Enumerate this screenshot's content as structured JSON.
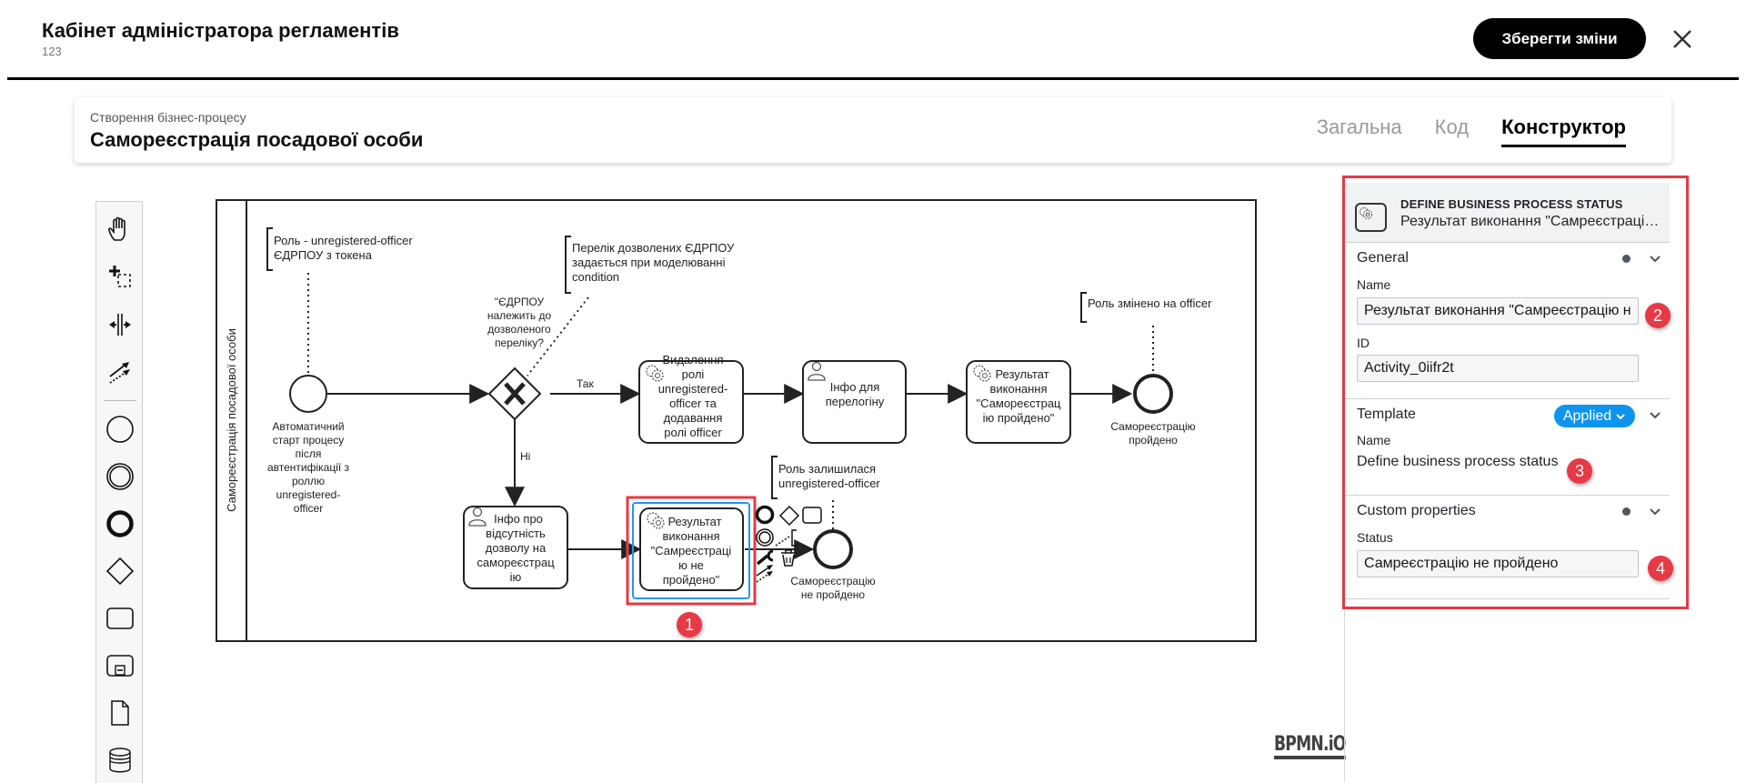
{
  "header": {
    "app_title": "Кабінет адміністратора регламентів",
    "app_subtitle": "123",
    "save_label": "Зберегти зміни",
    "close_icon": "close-icon"
  },
  "process": {
    "kicker": "Створення бізнес-процесу",
    "title": "Самореєстрація посадової особи",
    "tabs": [
      {
        "label": "Загальна",
        "active": false
      },
      {
        "label": "Код",
        "active": false
      },
      {
        "label": "Конструктор",
        "active": true
      }
    ]
  },
  "palette": {
    "tools": [
      "hand-tool-icon",
      "lasso-tool-icon",
      "space-tool-icon",
      "global-connect-tool-icon"
    ],
    "elements": [
      "start-event-icon",
      "intermediate-event-icon",
      "end-event-icon",
      "gateway-icon",
      "task-icon",
      "subprocess-icon",
      "data-object-icon",
      "data-store-icon"
    ]
  },
  "diagram": {
    "lane_label": "Самореєстрація посадової особи",
    "annotations": {
      "role_token": [
        "Роль - unregistered-officer",
        "ЄДРПОУ з токена"
      ],
      "edrpou_list": [
        "Перелік дозволених ЄДРПОУ",
        "задається при моделюванні",
        "condition"
      ],
      "role_changed": [
        "Роль змінено на officer"
      ],
      "role_stayed": [
        "Роль залишилася",
        "unregistered-officer"
      ]
    },
    "start_event_label": [
      "Автоматичний",
      "старт процесу",
      "після",
      "автентифікації з",
      "роллю",
      "unregistered-",
      "officer"
    ],
    "gateway_label": [
      "\"ЄДРПОУ",
      "належить до",
      "дозволеного",
      "переліку?"
    ],
    "flow_yes": "Так",
    "flow_no": "Ні",
    "tasks": {
      "remove_role": [
        "Видалення",
        "ролі",
        "unregistered-",
        "officer та",
        "додавання",
        "ролі officer"
      ],
      "relogin_info": [
        "Інфо для",
        "перелогіну"
      ],
      "result_success": [
        "Результат",
        "виконання",
        "\"Самореєстрац",
        "ію пройдено\""
      ],
      "no_permission_info": [
        "Інфо про",
        "відсутність",
        "дозволу на",
        "самореєстрац",
        "ію"
      ],
      "result_fail": [
        "Результат",
        "виконання",
        "\"Самреєстраці",
        "ю не",
        "пройдено\""
      ]
    },
    "end_success_label": [
      "Самореєстрацію",
      "пройдено"
    ],
    "end_fail_label": [
      "Самореєстрацію",
      "не пройдено"
    ],
    "logo": "BPMN.iO"
  },
  "properties": {
    "element_type": "DEFINE BUSINESS PROCESS STATUS",
    "element_name": "Результат виконання \"Самреєстраці…",
    "general": {
      "title": "General",
      "name_label": "Name",
      "name_value": "Результат виконання \"Самреєстрацію не пройдено\"",
      "id_label": "ID",
      "id_value": "Activity_0iifr2t"
    },
    "template": {
      "title": "Template",
      "badge": "Applied",
      "name_label": "Name",
      "name_value": "Define business process status"
    },
    "custom": {
      "title": "Custom properties",
      "status_label": "Status",
      "status_value": "Самреєстрацію не пройдено"
    }
  },
  "markers": [
    "1",
    "2",
    "3",
    "4"
  ],
  "colors": {
    "accent_blue": "#0e94ee",
    "highlight_red": "#e53945",
    "selection_blue": "#2196f3"
  }
}
